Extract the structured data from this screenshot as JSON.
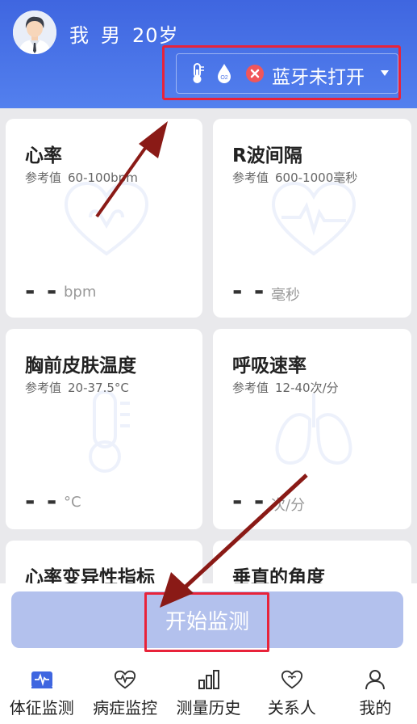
{
  "header": {
    "name": "我",
    "gender": "男",
    "age": "20岁",
    "bluetooth_status": "蓝牙未打开"
  },
  "cards": [
    {
      "title": "心率",
      "ref_label": "参考值",
      "ref_value": "60-100bpm",
      "dash": "- -",
      "unit": "bpm",
      "icon": "heart-icon"
    },
    {
      "title": "R波间隔",
      "ref_label": "参考值",
      "ref_value": "600-1000毫秒",
      "dash": "- -",
      "unit": "毫秒",
      "icon": "heart-wave-icon"
    },
    {
      "title": "胸前皮肤温度",
      "ref_label": "参考值",
      "ref_value": "20-37.5°C",
      "dash": "- -",
      "unit": "°C",
      "icon": "thermometer-icon"
    },
    {
      "title": "呼吸速率",
      "ref_label": "参考值",
      "ref_value": "12-40次/分",
      "dash": "- -",
      "unit": "次/分",
      "icon": "lungs-icon"
    },
    {
      "title": "心率变异性指标",
      "ref_label": "",
      "ref_value": "",
      "dash": "",
      "unit": "",
      "icon": ""
    },
    {
      "title": "垂直的角度",
      "ref_label": "",
      "ref_value": "",
      "dash": "",
      "unit": "",
      "icon": ""
    }
  ],
  "start_button": "开始监测",
  "tabs": [
    {
      "label": "体征监测",
      "icon": "pulse-icon",
      "active": true
    },
    {
      "label": "病症监控",
      "icon": "heart-monitor-icon",
      "active": false
    },
    {
      "label": "测量历史",
      "icon": "bar-chart-icon",
      "active": false
    },
    {
      "label": "关系人",
      "icon": "heart-people-icon",
      "active": false
    },
    {
      "label": "我的",
      "icon": "person-icon",
      "active": false
    }
  ],
  "colors": {
    "header_start": "#3f66e0",
    "header_end": "#5380ee",
    "accent": "#3f66e0",
    "annotation_red": "#e8233a",
    "close_red": "#f0565a",
    "start_button": "#b3c1ed"
  }
}
